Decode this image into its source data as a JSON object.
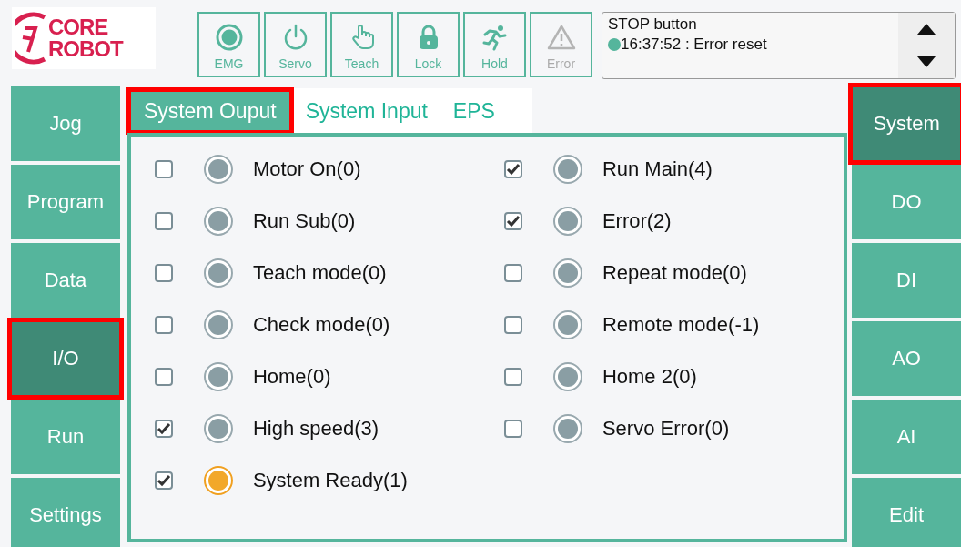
{
  "logo": {
    "line_1": "CORE",
    "line_2": "ROBOT"
  },
  "toolbar": [
    {
      "kind": "emg",
      "label": "EMG",
      "disabled": false
    },
    {
      "kind": "servo",
      "label": "Servo",
      "disabled": false
    },
    {
      "kind": "teach",
      "label": "Teach",
      "disabled": false
    },
    {
      "kind": "lock",
      "label": "Lock",
      "disabled": false
    },
    {
      "kind": "hold",
      "label": "Hold",
      "disabled": false
    },
    {
      "kind": "error",
      "label": "Error",
      "disabled": true
    }
  ],
  "messages": {
    "lines": [
      {
        "text": "STOP button",
        "alert": false
      },
      {
        "text": "16:37:52 : Error reset",
        "alert": true
      }
    ]
  },
  "left_nav": [
    {
      "label": "Jog",
      "selected": false
    },
    {
      "label": "Program",
      "selected": false
    },
    {
      "label": "Data",
      "selected": false
    },
    {
      "label": "I/O",
      "selected": true
    },
    {
      "label": "Run",
      "selected": false
    },
    {
      "label": "Settings",
      "selected": false
    }
  ],
  "right_nav": [
    {
      "label": "System",
      "selected": true
    },
    {
      "label": "DO",
      "selected": false
    },
    {
      "label": "DI",
      "selected": false
    },
    {
      "label": "AO",
      "selected": false
    },
    {
      "label": "AI",
      "selected": false
    },
    {
      "label": "Edit",
      "selected": false
    }
  ],
  "tabs": [
    {
      "label": "System Ouput",
      "selected": true
    },
    {
      "label": "System Input",
      "selected": false
    },
    {
      "label": "EPS",
      "selected": false
    }
  ],
  "signals_left": [
    {
      "label": "Motor On(0)",
      "checked": false,
      "on": false
    },
    {
      "label": "Run Sub(0)",
      "checked": false,
      "on": false
    },
    {
      "label": "Teach mode(0)",
      "checked": false,
      "on": false
    },
    {
      "label": "Check mode(0)",
      "checked": false,
      "on": false
    },
    {
      "label": "Home(0)",
      "checked": false,
      "on": false
    },
    {
      "label": "High speed(3)",
      "checked": true,
      "on": false
    },
    {
      "label": "System Ready(1)",
      "checked": true,
      "on": true
    }
  ],
  "signals_right": [
    {
      "label": "Run Main(4)",
      "checked": true,
      "on": false
    },
    {
      "label": "Error(2)",
      "checked": true,
      "on": false
    },
    {
      "label": "Repeat mode(0)",
      "checked": false,
      "on": false
    },
    {
      "label": "Remote mode(-1)",
      "checked": false,
      "on": false
    },
    {
      "label": "Home 2(0)",
      "checked": false,
      "on": false
    },
    {
      "label": "Servo Error(0)",
      "checked": false,
      "on": false
    }
  ]
}
